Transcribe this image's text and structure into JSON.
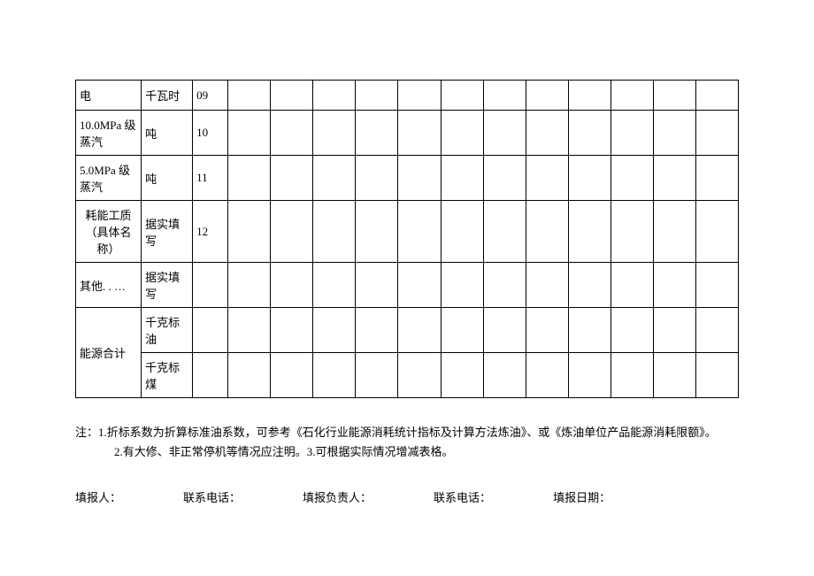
{
  "table": {
    "rows": [
      {
        "name": "电",
        "unit": "千瓦时",
        "code": "09"
      },
      {
        "name": "10.0MPa 级蒸汽",
        "unit": "吨",
        "code": "10"
      },
      {
        "name": "5.0MPa 级蒸汽",
        "unit": "吨",
        "code": "11"
      },
      {
        "name": "耗能工质（具体名称）",
        "unit": "据实填写",
        "code": "12"
      },
      {
        "name": "其他. . …",
        "unit": "据实填写",
        "code": ""
      }
    ],
    "summary": {
      "label": "能源合计",
      "unit1": "千克标油",
      "unit2": "千克标煤"
    }
  },
  "notes": {
    "line1": "注：1.折标系数为折算标准油系数，可参考《石化行业能源消耗统计指标及计算方法炼油》、或《炼油单位产品能源消耗限额》。",
    "line2": "2.有大修、非正常停机等情况应注明。3.可根据实际情况增减表格。"
  },
  "footer": {
    "reporter_label": "填报人：",
    "phone1_label": "联系电话：",
    "manager_label": "填报负责人：",
    "phone2_label": "联系电话：",
    "date_label": "填报日期："
  }
}
